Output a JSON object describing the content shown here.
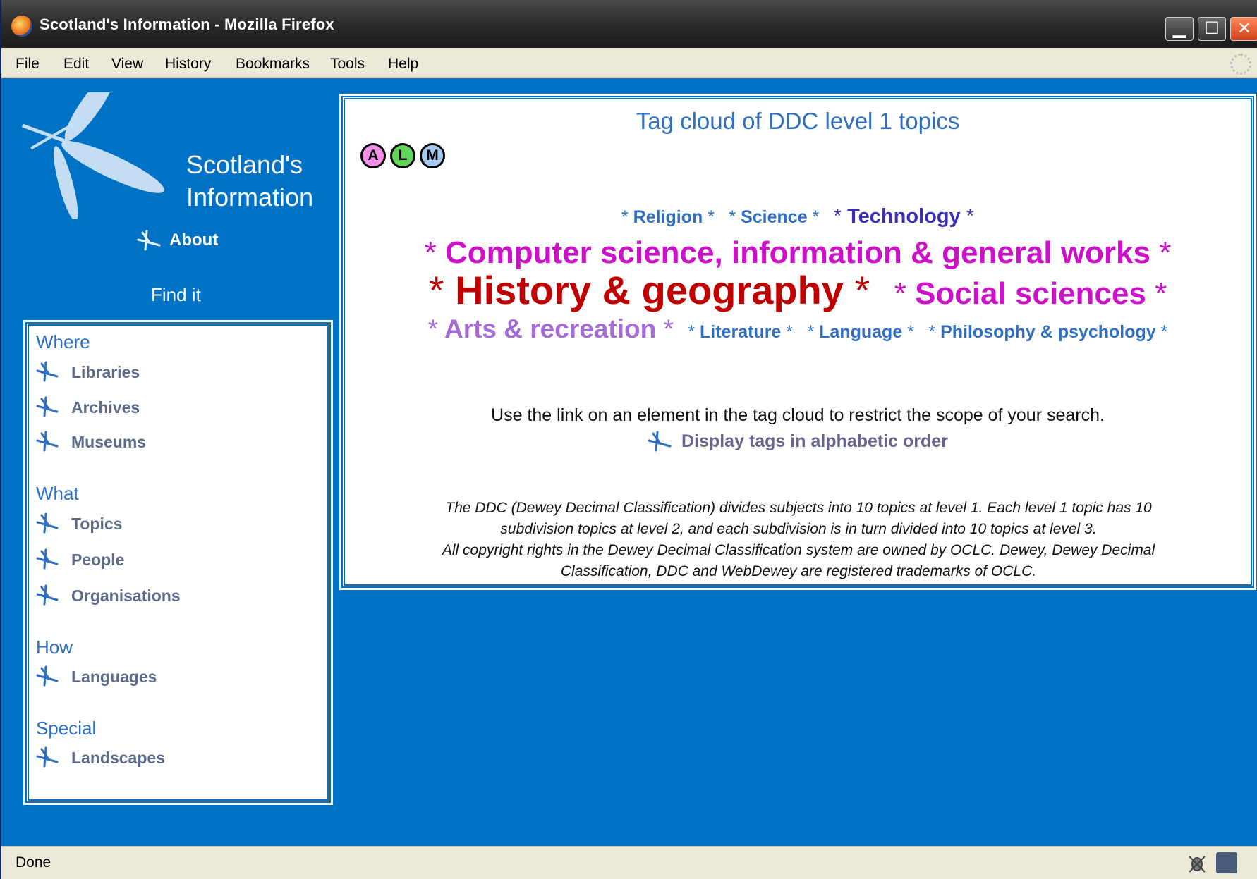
{
  "window": {
    "title": "Scotland's Information - Mozilla Firefox",
    "controls": {
      "minimize": "▁",
      "maximize": "☐",
      "close": "✕"
    }
  },
  "menubar": {
    "items": [
      "File",
      "Edit",
      "View",
      "History",
      "Bookmarks",
      "Tools",
      "Help"
    ]
  },
  "sidebar": {
    "site_title_line1": "Scotland's",
    "site_title_line2": "Information",
    "about_label": "About",
    "find_it_label": "Find it",
    "sections": [
      {
        "heading": "Where",
        "items": [
          "Libraries",
          "Archives",
          "Museums"
        ]
      },
      {
        "heading": "What",
        "items": [
          "Topics",
          "People",
          "Organisations"
        ]
      },
      {
        "heading": "How",
        "items": [
          "Languages"
        ]
      },
      {
        "heading": "Special",
        "items": [
          "Landscapes"
        ]
      }
    ]
  },
  "main": {
    "title": "Tag cloud of DDC level 1 topics",
    "letter_buttons": [
      "A",
      "L",
      "M"
    ],
    "star": "*",
    "tags": [
      {
        "label": "Religion",
        "color": "#2e6fc4"
      },
      {
        "label": "Science",
        "color": "#2e6fc4"
      },
      {
        "label": "Technology",
        "color": "#3a2fb4"
      },
      {
        "label": "Computer science, information & general works",
        "color": "#cc11c9"
      },
      {
        "label": "History & geography",
        "color": "#c00000"
      },
      {
        "label": "Social sciences",
        "color": "#cc11c9"
      },
      {
        "label": "Arts & recreation",
        "color": "#a46ad6"
      },
      {
        "label": "Literature",
        "color": "#2e6fc4"
      },
      {
        "label": "Language",
        "color": "#2e6fc4"
      },
      {
        "label": "Philosophy & psychology",
        "color": "#2e6fc4"
      }
    ],
    "hint": "Use the link on an element in the tag cloud to restrict the scope of your search.",
    "alpha_link": "Display tags in alphabetic order",
    "note_line1": "The DDC (Dewey Decimal Classification) divides subjects into 10 topics at level 1. Each level 1 topic has 10",
    "note_line2": "subdivision topics at level 2, and each subdivision is in turn divided into 10 topics at level 3.",
    "note_line3": "All copyright rights in the Dewey Decimal Classification system are owned by OCLC. Dewey, Dewey Decimal",
    "note_line4": "Classification, DDC and WebDewey are registered trademarks of OCLC."
  },
  "statusbar": {
    "status": "Done"
  },
  "colors": {
    "page_background": "#0072c6",
    "link_blue": "#2e6fc4",
    "nav_gray": "#5c6a8c"
  }
}
